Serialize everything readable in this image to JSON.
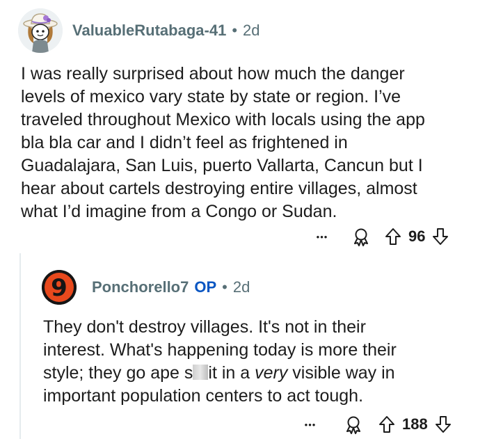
{
  "comments": [
    {
      "username": "ValuableRutabaga-41",
      "separator": "•",
      "age": "2d",
      "body_lines": [
        "I was really surprised about how much the danger",
        "levels of mexico vary state by state or region. I’ve",
        "traveled throughout Mexico with locals using the app",
        "bla bla car and I didn’t feel as frightened in",
        "Guadalajara, San Luis, puerto Vallarta, Cancun but I",
        "hear about cartels destroying entire villages, almost",
        "what I’d imagine from a Congo or Sudan."
      ],
      "more_label": "•••",
      "votes": "96",
      "avatar_icon": "snoo-avatar-icon"
    },
    {
      "username": "Ponchorello7",
      "op_badge": "OP",
      "separator": "•",
      "age": "2d",
      "avatar_digit": "9",
      "body": {
        "line1": "They don't destroy villages. It's not in their",
        "line2": "interest. What's happening today is more their",
        "line3_pre": "style; they go ape s",
        "line3_post": "it in a ",
        "line3_em": "very",
        "line3_end": " visible way in",
        "line4": "important population centers to act tough."
      },
      "more_label": "•••",
      "votes": "188"
    }
  ],
  "colors": {
    "meta": "#576f76",
    "op": "#0a56c2",
    "text": "#1c1c1c",
    "thread": "#e5ebee"
  }
}
